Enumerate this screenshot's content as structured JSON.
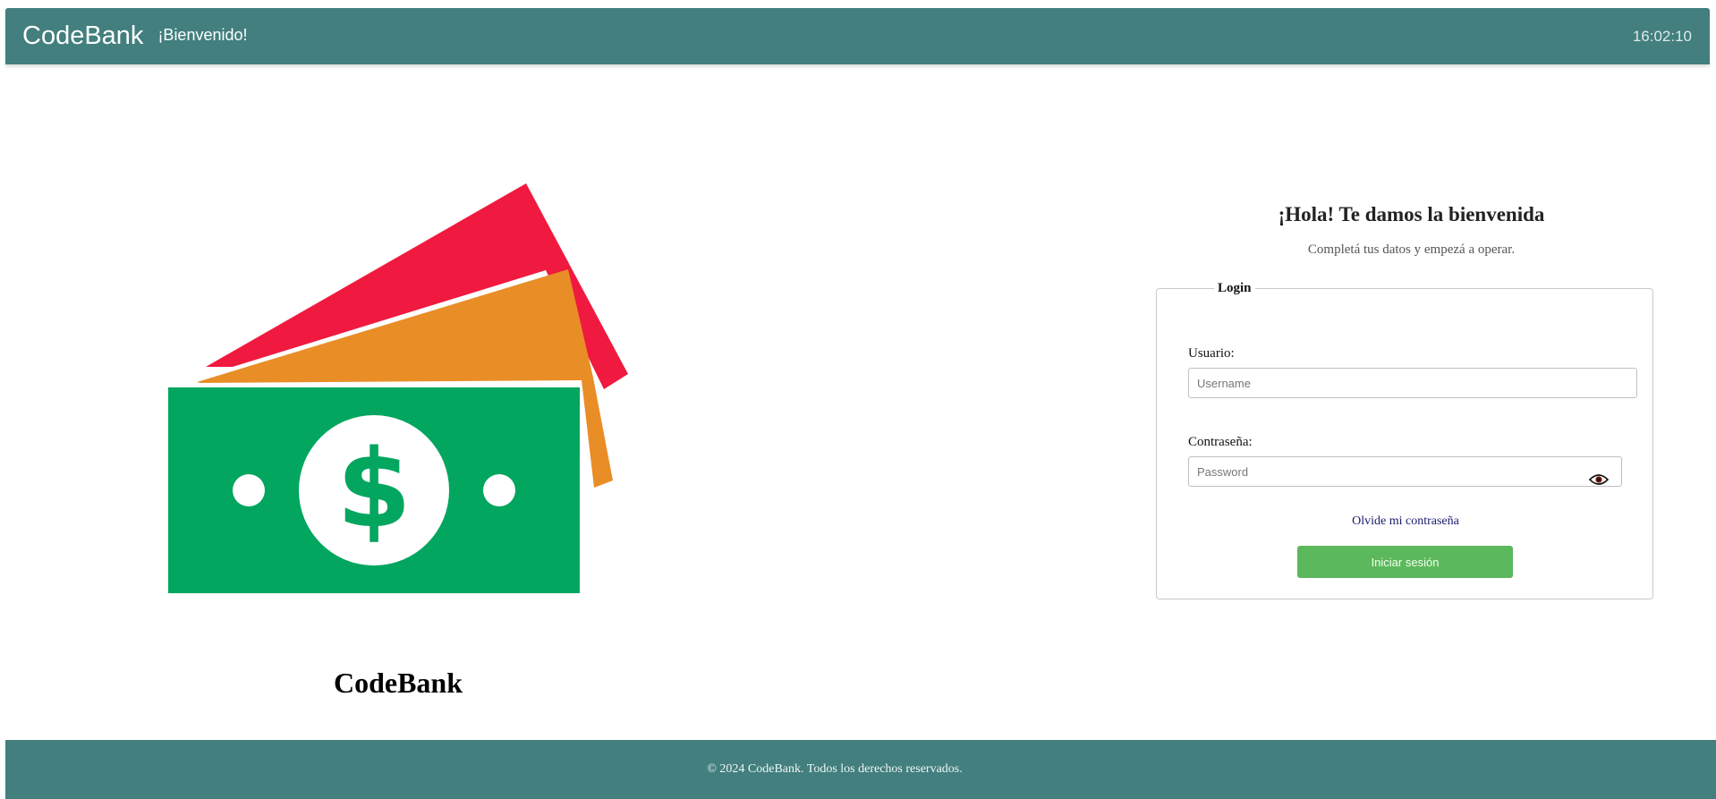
{
  "header": {
    "brand": "CodeBank",
    "welcome": "¡Bienvenido!",
    "clock": "16:02:10",
    "bg_color": "#427f7e"
  },
  "hero": {
    "icon": "money-bills-icon",
    "title": "CodeBank",
    "colors": {
      "red": "#f0193f",
      "orange": "#e98d27",
      "green": "#02a65f"
    }
  },
  "login": {
    "heading": "¡Hola! Te damos la bienvenida",
    "subheading": "Completá tus datos y empezá a operar.",
    "legend": "Login",
    "username_label": "Usuario:",
    "username_placeholder": "Username",
    "username_value": "",
    "password_label": "Contraseña:",
    "password_placeholder": "Password",
    "password_value": "",
    "show_password_icon": "eye-icon",
    "forgot_link": "Olvide mi contraseña",
    "submit_label": "Iniciar sesión",
    "submit_color": "#5cb85c"
  },
  "footer": {
    "text": "© 2024 CodeBank. Todos los derechos reservados."
  }
}
